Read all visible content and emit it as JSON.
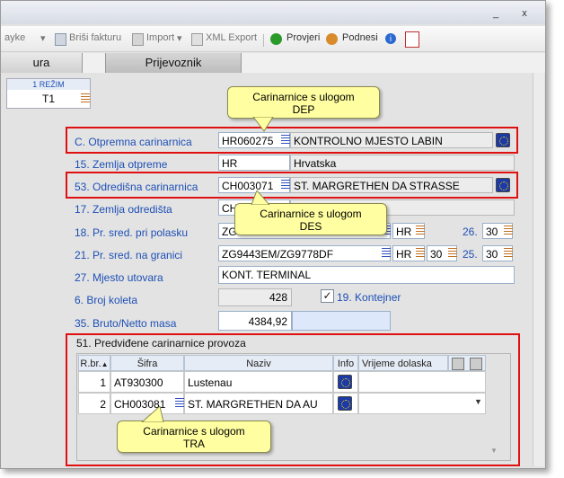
{
  "window": {
    "controls": {
      "minimize": "_",
      "close": "x"
    }
  },
  "toolbar": {
    "partial_item": "ayke",
    "delete_invoice": "Briši fakturu",
    "import": "Import",
    "xml_export": "XML Export",
    "check": "Provjeri",
    "submit": "Podnesi",
    "info": "i"
  },
  "tabs": [
    {
      "label": "ura"
    },
    {
      "label": "Prijevoznik"
    }
  ],
  "mode": {
    "header": "1 REŽIM",
    "value": "T1"
  },
  "fields": {
    "departure_office": {
      "label": "C. Otpremna carinarnica",
      "code": "HR060275",
      "name": "KONTROLNO MJESTO LABIN"
    },
    "dispatch_country": {
      "label": "15. Zemlja otpreme",
      "code": "HR",
      "name": "Hrvatska"
    },
    "destination_office": {
      "label": "53. Odredišna carinarnica",
      "code": "CH003071",
      "name": "ST. MARGRETHEN DA STRASSE"
    },
    "destination_country": {
      "label": "17. Zemlja odredišta",
      "code": "CH"
    },
    "transport_departure": {
      "label": "18. Pr. sred. pri polasku",
      "value": "ZG",
      "country": "HR",
      "field_no": "26.",
      "field_val": "30"
    },
    "transport_border": {
      "label": "21. Pr. sred. na granici",
      "value": "ZG9443EM/ZG9778DF",
      "country": "HR",
      "mode_val": "30",
      "field_no": "25.",
      "field_val": "30"
    },
    "loading_place": {
      "label": "27. Mjesto utovara",
      "value": "KONT. TERMINAL"
    },
    "packages": {
      "label": "6. Broj koleta",
      "value": "428"
    },
    "container": {
      "label": "19. Kontejner",
      "mark": "✓"
    },
    "mass": {
      "label": "35. Bruto/Netto masa",
      "gross": "4384,92",
      "net": ""
    }
  },
  "transit": {
    "title": "51. Predviđene carinarnice provoza",
    "columns": {
      "rbr": "R.br.",
      "code": "Šifra",
      "name": "Naziv",
      "info": "Info",
      "arrival": "Vrijeme dolaska"
    },
    "rows": [
      {
        "no": "1",
        "code": "AT930300",
        "name": "Lustenau",
        "arrival": ""
      },
      {
        "no": "2",
        "code": "CH003081",
        "name": "ST. MARGRETHEN DA AU",
        "arrival": ""
      }
    ]
  },
  "callouts": {
    "dep_line1": "Carinarnice s ulogom",
    "dep_line2": "DEP",
    "des_line1": "Carinarnice s ulogom",
    "des_line2": "DES",
    "tra_line1": "Carinarnice s ulogom",
    "tra_line2": "TRA"
  },
  "colors": {
    "highlight": "#e01010",
    "callout_bg": "#fffea0",
    "label": "#1d4fb5"
  }
}
